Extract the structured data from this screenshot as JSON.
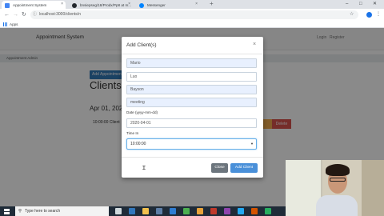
{
  "browser": {
    "tabs": [
      {
        "title": "Appointment System",
        "active": true,
        "favicon_color": "#4285f4"
      },
      {
        "title": "bnsiepseg/18/Prodx/Pp8 at m...",
        "active": false,
        "favicon_color": "#24292e"
      },
      {
        "title": "Messenger",
        "active": false,
        "favicon_color": "#0084ff"
      }
    ],
    "new_tab": "+",
    "window_controls": [
      "–",
      "□",
      "✕"
    ],
    "url": "localhost:3000/clients/n",
    "bookmarks": {
      "apps_label": "Apps"
    }
  },
  "page": {
    "brand": "Appointment System",
    "nav_links": [
      "Login",
      "Register"
    ],
    "subnav": "Appointment Admin",
    "add_button": "Add Appointment",
    "heading": "Clients",
    "date_heading": "Apr 01, 2020 10:00",
    "row_text": "10:00:00 Client",
    "delete_button": "Delete"
  },
  "modal": {
    "title": "Add Client(s)",
    "close": "×",
    "fields": [
      {
        "value": "Mario",
        "filled": true
      },
      {
        "value": "Luo",
        "filled": false
      },
      {
        "value": "Bayson",
        "filled": true
      },
      {
        "value": "meeting",
        "filled": true
      }
    ],
    "date_label": "Date (yyyy-mm-dd)",
    "date_value": "2020-04-01",
    "time_label": "Time In",
    "time_value": "10:00:00",
    "close_button": "Close",
    "add_button": "Add Client"
  },
  "taskbar": {
    "search_placeholder": "Type here to search",
    "icons": [
      {
        "name": "task-view-icon",
        "color": "#cfd8dc"
      },
      {
        "name": "edge-icon",
        "color": "#3277bc"
      },
      {
        "name": "file-explorer-icon",
        "color": "#f2c14e"
      },
      {
        "name": "store-icon",
        "color": "#5e7ea6"
      },
      {
        "name": "mail-icon",
        "color": "#2f7dd3"
      },
      {
        "name": "chrome-icon",
        "color": "#4caf50"
      },
      {
        "name": "app-icon-1",
        "color": "#e8a33b"
      },
      {
        "name": "app-icon-2",
        "color": "#c0392b"
      },
      {
        "name": "app-icon-3",
        "color": "#8e44ad"
      },
      {
        "name": "vscode-icon",
        "color": "#23a9f2"
      },
      {
        "name": "app-icon-4",
        "color": "#d35400"
      },
      {
        "name": "app-icon-5",
        "color": "#27ae60"
      }
    ]
  }
}
